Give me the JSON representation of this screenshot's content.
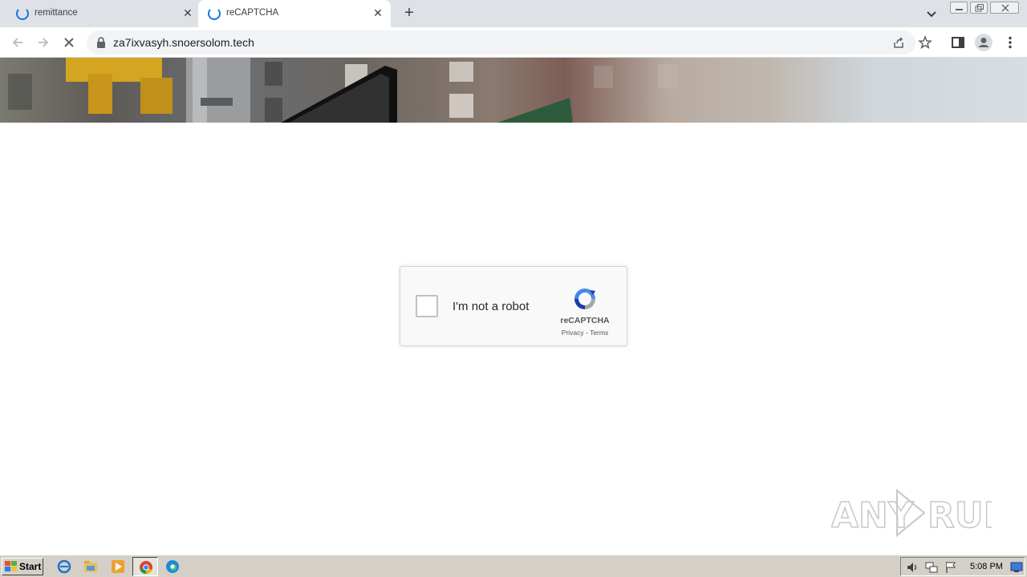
{
  "browser": {
    "tabs": [
      {
        "title": "remittance",
        "state": "loading"
      },
      {
        "title": "reCAPTCHA",
        "state": "loading",
        "active": true
      }
    ],
    "new_tab_glyph": "+",
    "close_glyph": "✕",
    "url": "za7ixvasyh.snoersolom.tech"
  },
  "recaptcha": {
    "label": "I'm not a robot",
    "brand": "reCAPTCHA",
    "links": "Privacy - Terms"
  },
  "watermark": {
    "text": "ANY RUN"
  },
  "taskbar": {
    "start_label": "Start",
    "clock": "5:08 PM"
  },
  "colors": {
    "accent": "#1a73e8",
    "tabstrip": "#dee1e6",
    "taskbar": "#d4d0c8"
  }
}
